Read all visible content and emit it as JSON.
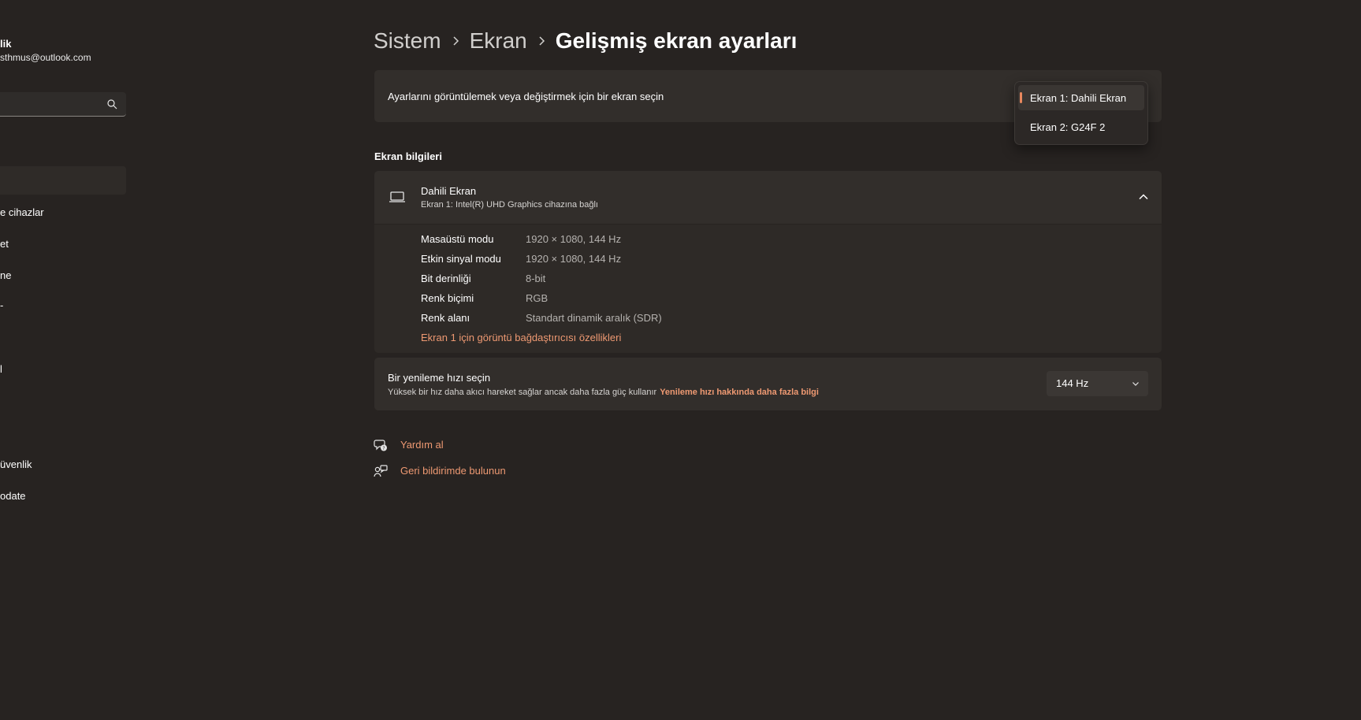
{
  "sidebar": {
    "user_name": "lik",
    "user_email": "sthmus@outlook.com",
    "items": [
      {
        "label": "e cihazlar"
      },
      {
        "label": "et"
      },
      {
        "label": "ne"
      },
      {
        "label": "-"
      },
      {
        "label": "l"
      },
      {
        "label": "üvenlik"
      },
      {
        "label": "odate"
      }
    ]
  },
  "breadcrumb": {
    "items": [
      "Sistem",
      "Ekran"
    ],
    "current": "Gelişmiş ekran ayarları"
  },
  "display_select": {
    "label": "Ayarlarını görüntülemek veya değiştirmek için bir ekran seçin",
    "options": [
      "Ekran 1: Dahili Ekran",
      "Ekran 2: G24F 2"
    ],
    "selected_index": 0
  },
  "display_info": {
    "section_title": "Ekran bilgileri",
    "title": "Dahili Ekran",
    "subtitle": "Ekran 1: Intel(R) UHD Graphics cihazına bağlı",
    "rows": [
      {
        "label": "Masaüstü modu",
        "value": "1920 × 1080, 144 Hz"
      },
      {
        "label": "Etkin sinyal modu",
        "value": "1920 × 1080, 144 Hz"
      },
      {
        "label": "Bit derinliği",
        "value": "8-bit"
      },
      {
        "label": "Renk biçimi",
        "value": "RGB"
      },
      {
        "label": "Renk alanı",
        "value": "Standart dinamik aralık (SDR)"
      }
    ],
    "adapter_link": "Ekran 1 için görüntü bağdaştırıcısı özellikleri"
  },
  "refresh_rate": {
    "title": "Bir yenileme hızı seçin",
    "description": "Yüksek bir hız daha akıcı hareket sağlar ancak daha fazla güç kullanır",
    "link": "Yenileme hızı hakkında daha fazla bilgi",
    "value": "144 Hz"
  },
  "help": {
    "get_help": "Yardım al",
    "feedback": "Geri bildirimde bulunun"
  },
  "colors": {
    "background": "#272321",
    "card": "#322e2b",
    "accent": "#ee9972"
  }
}
